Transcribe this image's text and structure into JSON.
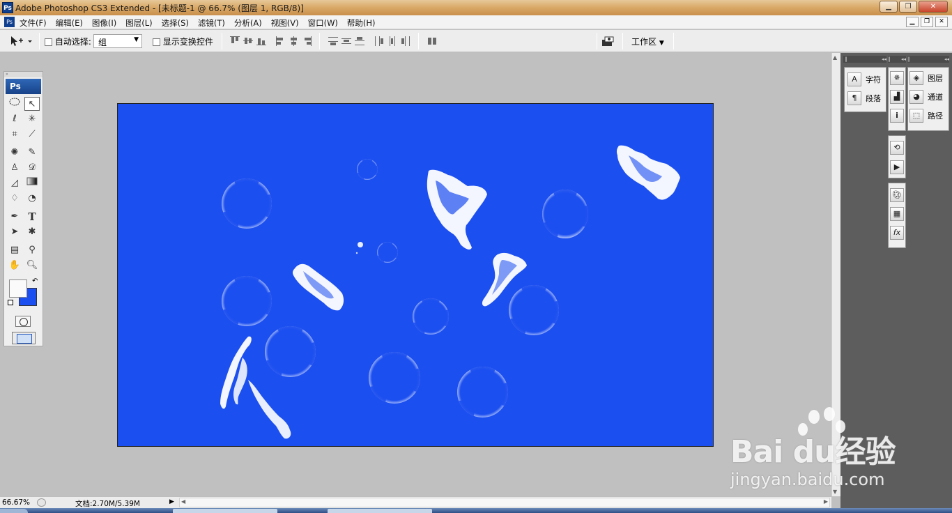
{
  "window": {
    "title": "Adobe Photoshop CS3 Extended - [未标题-1 @ 66.7% (图层 1, RGB/8)]",
    "app_icon": "Ps",
    "controls": [
      "minimize-icon",
      "restore-icon",
      "close-icon"
    ]
  },
  "menu": {
    "items": [
      "文件(F)",
      "编辑(E)",
      "图像(I)",
      "图层(L)",
      "选择(S)",
      "滤镜(T)",
      "分析(A)",
      "视图(V)",
      "窗口(W)",
      "帮助(H)"
    ]
  },
  "options_bar": {
    "auto_select_label": "自动选择:",
    "auto_select_value": "组",
    "show_transform_label": "显示变换控件",
    "workspace_label": "工作区"
  },
  "toolbox": {
    "logo": "Ps",
    "foreground_color": "#fafafa",
    "background_color": "#1c4ff0"
  },
  "canvas": {
    "background_color": "#1c4ff0"
  },
  "panels": {
    "group1": [
      {
        "icon": "character-icon",
        "glyph": "A",
        "label": "字符"
      },
      {
        "icon": "paragraph-icon",
        "glyph": "¶",
        "label": "段落"
      }
    ],
    "group3": [
      {
        "icon": "layers-icon",
        "label": "图层"
      },
      {
        "icon": "channels-icon",
        "label": "通道"
      },
      {
        "icon": "paths-icon",
        "label": "路径"
      }
    ]
  },
  "status": {
    "zoom": "66.67%",
    "doc_size": "文档:2.70M/5.39M"
  },
  "watermark": {
    "brand": "Bai du经验",
    "url": "jingyan.baidu.com"
  }
}
